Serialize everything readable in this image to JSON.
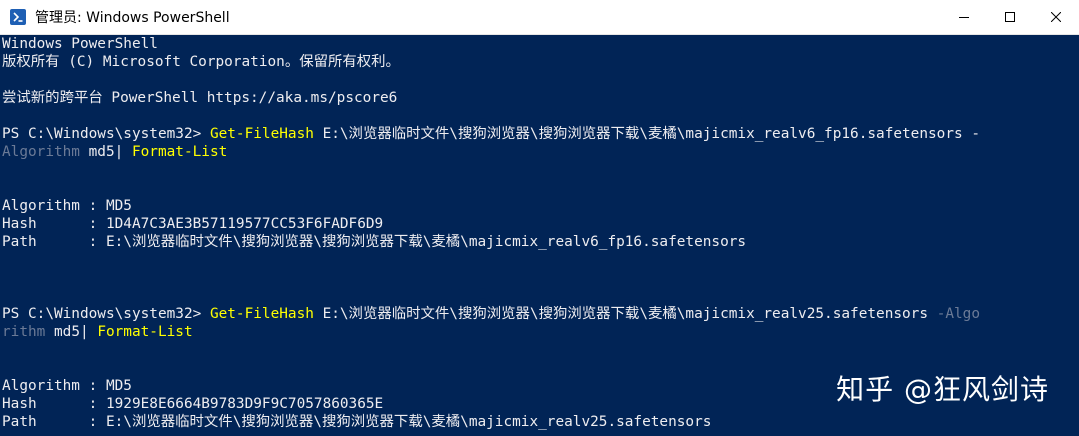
{
  "window": {
    "title": "管理员: Windows PowerShell",
    "icon": "powershell-icon",
    "controls": [
      "minimize-icon",
      "maximize-icon",
      "close-icon"
    ]
  },
  "colors": {
    "console_bg": "#012456",
    "text": "#eeedf0",
    "command": "#ffff00",
    "parameter": "#6b7a96"
  },
  "console": {
    "line1": "Windows PowerShell",
    "line2": "版权所有 (C) Microsoft Corporation。保留所有权利。",
    "line3": "尝试新的跨平台 PowerShell https://aka.ms/pscore6",
    "cmd1": {
      "prompt": "PS C:\\Windows\\system32> ",
      "command": "Get-FileHash",
      "args": " E:\\浏览器临时文件\\搜狗浏览器\\搜狗浏览器下载\\麦橘\\majicmix_realv6_fp16.safetensors -",
      "cont_param": "Algorithm",
      "cont_value": " md5| ",
      "pipe_cmd": "Format-List"
    },
    "out1": {
      "algorithm": "Algorithm : MD5",
      "hash": "Hash      : 1D4A7C3AE3B57119577CC53F6FADF6D9",
      "path": "Path      : E:\\浏览器临时文件\\搜狗浏览器\\搜狗浏览器下载\\麦橘\\majicmix_realv6_fp16.safetensors"
    },
    "cmd2": {
      "prompt": "PS C:\\Windows\\system32> ",
      "command": "Get-FileHash",
      "args": " E:\\浏览器临时文件\\搜狗浏览器\\搜狗浏览器下载\\麦橘\\majicmix_realv25.safetensors ",
      "param_start": "-Algo",
      "cont_param": "rithm",
      "cont_value": " md5| ",
      "pipe_cmd": "Format-List"
    },
    "out2": {
      "algorithm": "Algorithm : MD5",
      "hash": "Hash      : 1929E8E6664B9783D9F9C7057860365E",
      "path": "Path      : E:\\浏览器临时文件\\搜狗浏览器\\搜狗浏览器下载\\麦橘\\majicmix_realv25.safetensors"
    }
  },
  "watermark": "知乎 @狂风剑诗"
}
